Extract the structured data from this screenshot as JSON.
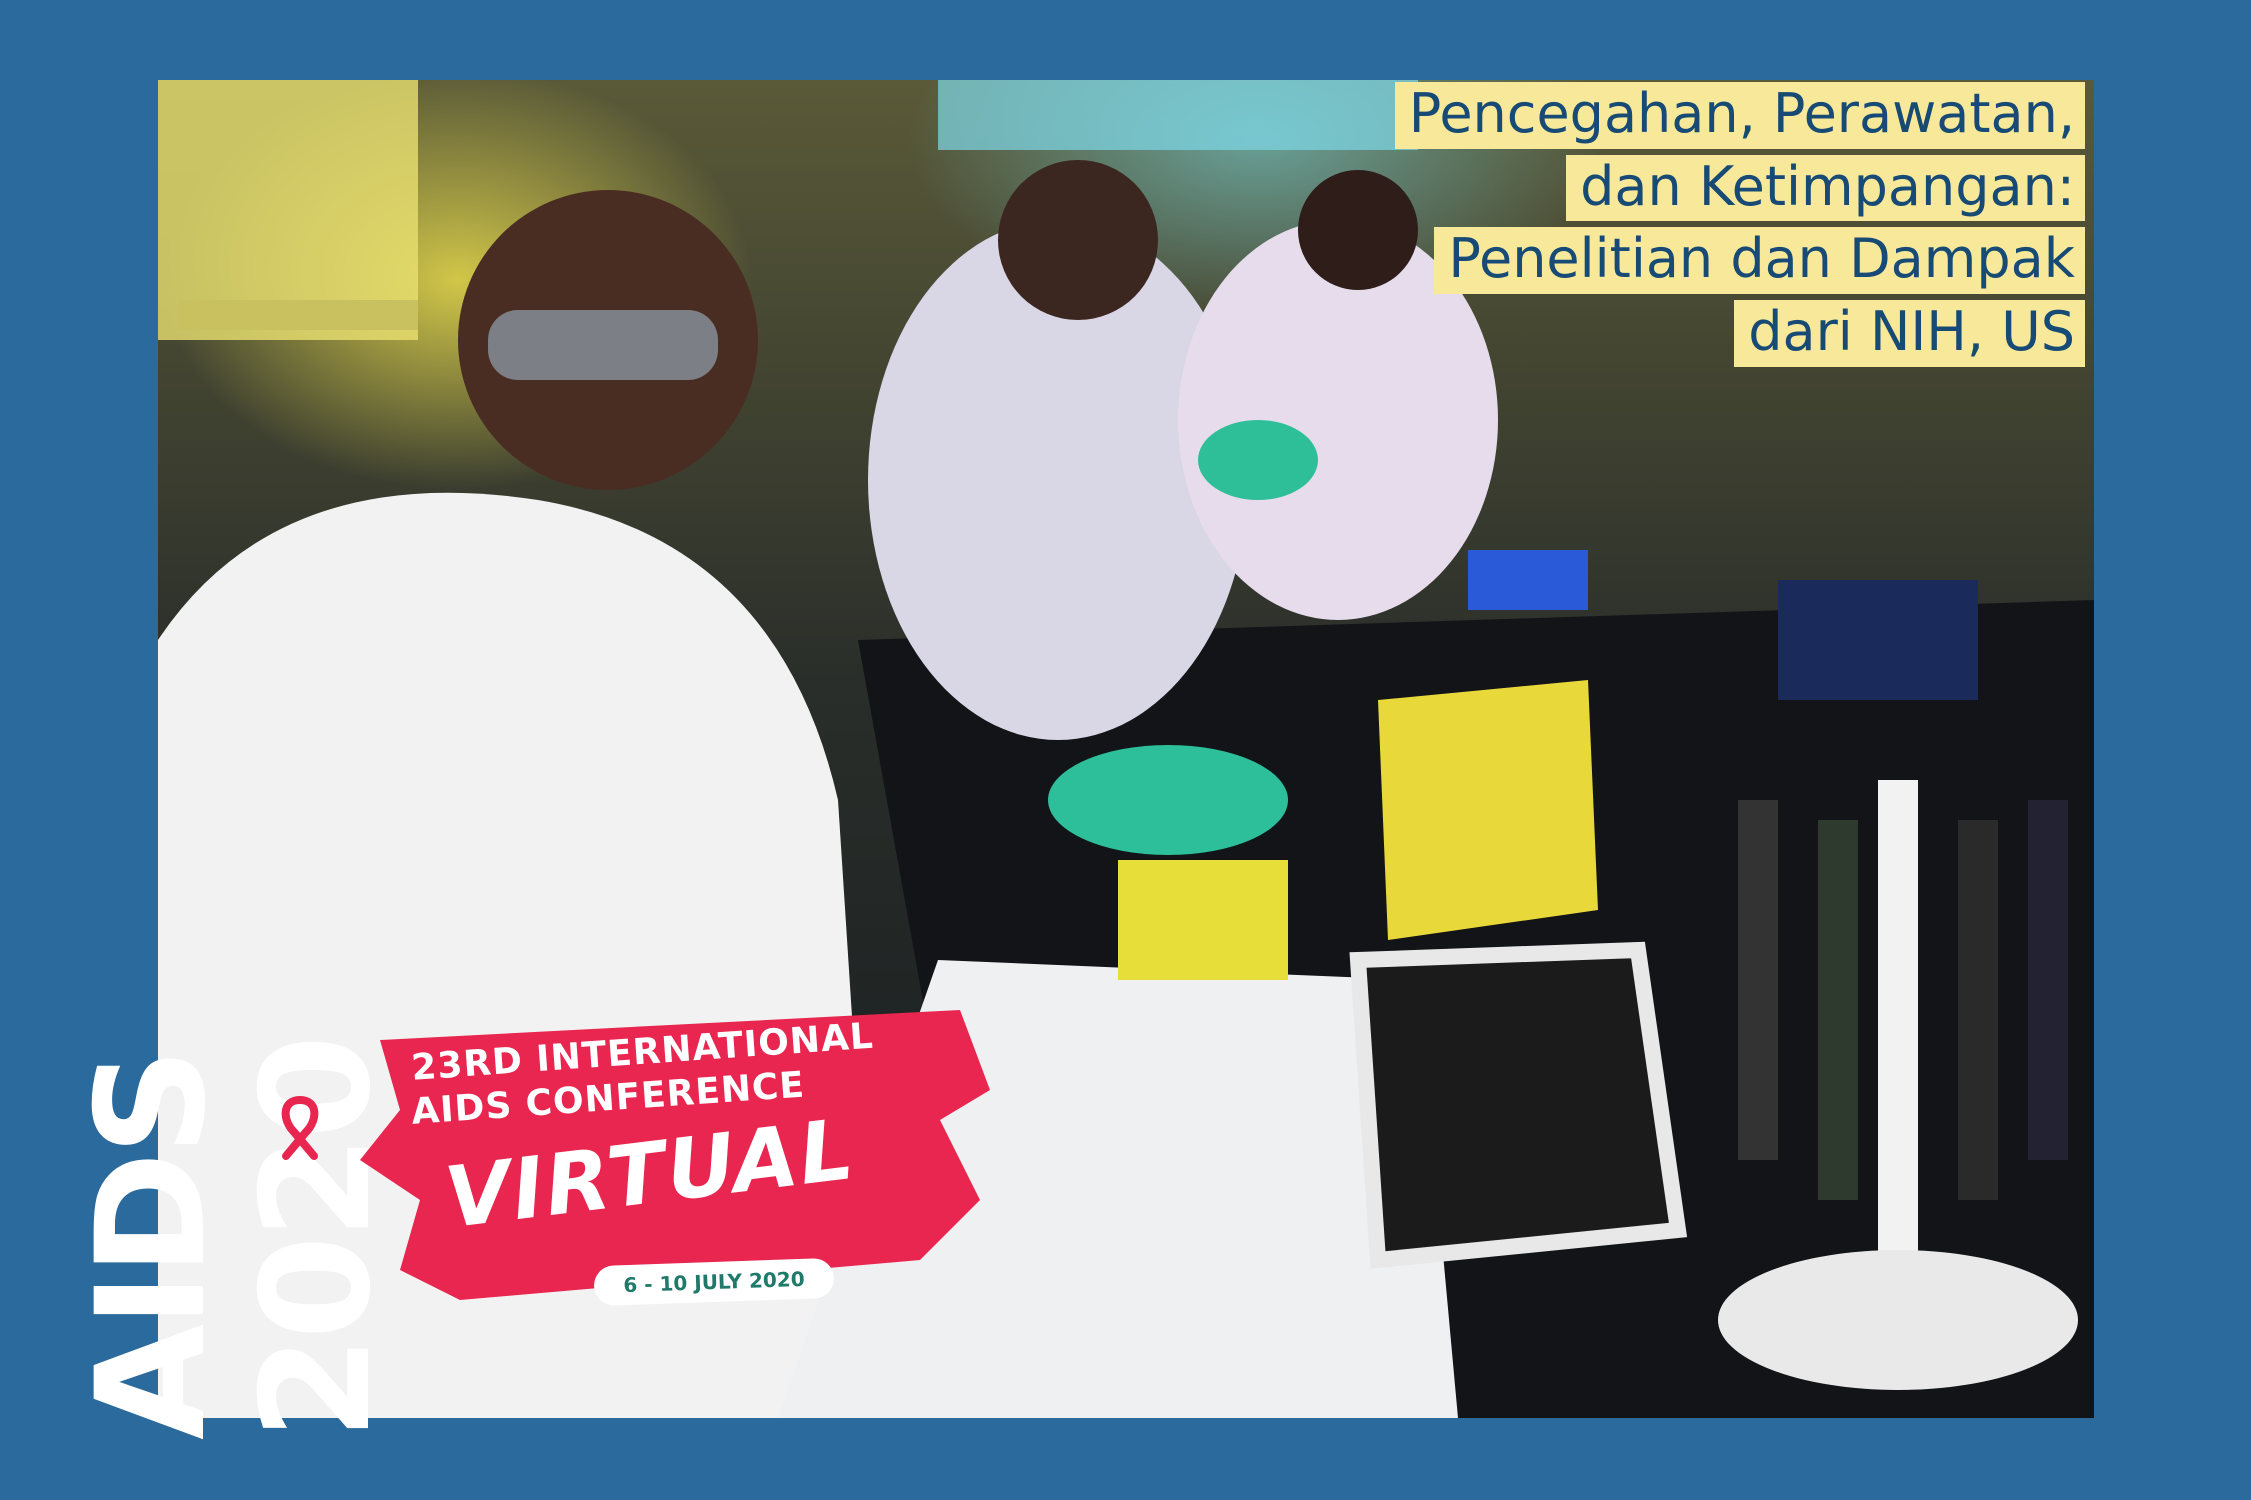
{
  "headline": {
    "line1": "Pencegahan, Perawatan,",
    "line2": "dan Ketimpangan:",
    "line3": "Penelitian dan Dampak",
    "line4": "dari NIH, US"
  },
  "logo": {
    "aids": "AIDS",
    "year": "2020"
  },
  "banner": {
    "line1": "23RD INTERNATIONAL",
    "line2": "AIDS CONFERENCE",
    "virtual": "VIRTUAL",
    "date": "6 - 10 JULY 2020"
  },
  "colors": {
    "frame": "#2a6a9c",
    "highlight": "#f8e99a",
    "headline_text": "#174a74",
    "banner_red": "#e8264f",
    "ribbon_red": "#e8264f"
  }
}
